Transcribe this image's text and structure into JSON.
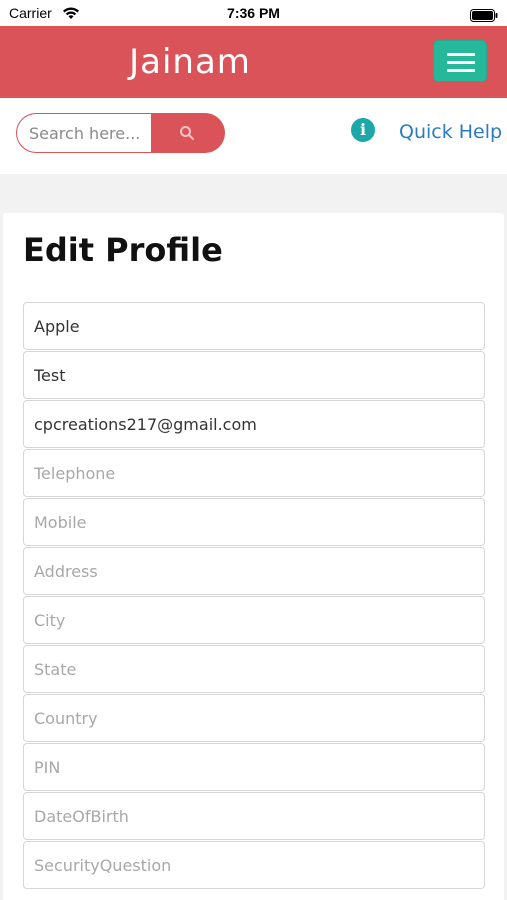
{
  "status_bar": {
    "carrier": "Carrier",
    "time": "7:36 PM"
  },
  "header": {
    "brand": "Jainam"
  },
  "search": {
    "placeholder": "Search here...",
    "quick_help_label": "Quick Help"
  },
  "profile": {
    "title": "Edit Profile",
    "fields": [
      {
        "name": "first-name",
        "value": "Apple",
        "placeholder": ""
      },
      {
        "name": "last-name",
        "value": "Test",
        "placeholder": ""
      },
      {
        "name": "email",
        "value": "cpcreations217@gmail.com",
        "placeholder": ""
      },
      {
        "name": "telephone",
        "value": "",
        "placeholder": "Telephone"
      },
      {
        "name": "mobile",
        "value": "",
        "placeholder": "Mobile"
      },
      {
        "name": "address",
        "value": "",
        "placeholder": "Address"
      },
      {
        "name": "city",
        "value": "",
        "placeholder": "City"
      },
      {
        "name": "state",
        "value": "",
        "placeholder": "State"
      },
      {
        "name": "country",
        "value": "",
        "placeholder": "Country"
      },
      {
        "name": "pin",
        "value": "",
        "placeholder": "PIN"
      },
      {
        "name": "date-of-birth",
        "value": "",
        "placeholder": "DateOfBirth"
      },
      {
        "name": "security-question",
        "value": "",
        "placeholder": "SecurityQuestion"
      }
    ]
  },
  "colors": {
    "brand_red": "#d95358",
    "menu_green": "#26b89a",
    "link_blue": "#2a7cc0",
    "info_teal": "#1ea7a9"
  },
  "icons": {
    "wifi": "wifi-icon",
    "battery": "battery-icon",
    "menu": "hamburger-menu-icon",
    "search": "search-icon",
    "info": "info-icon"
  }
}
